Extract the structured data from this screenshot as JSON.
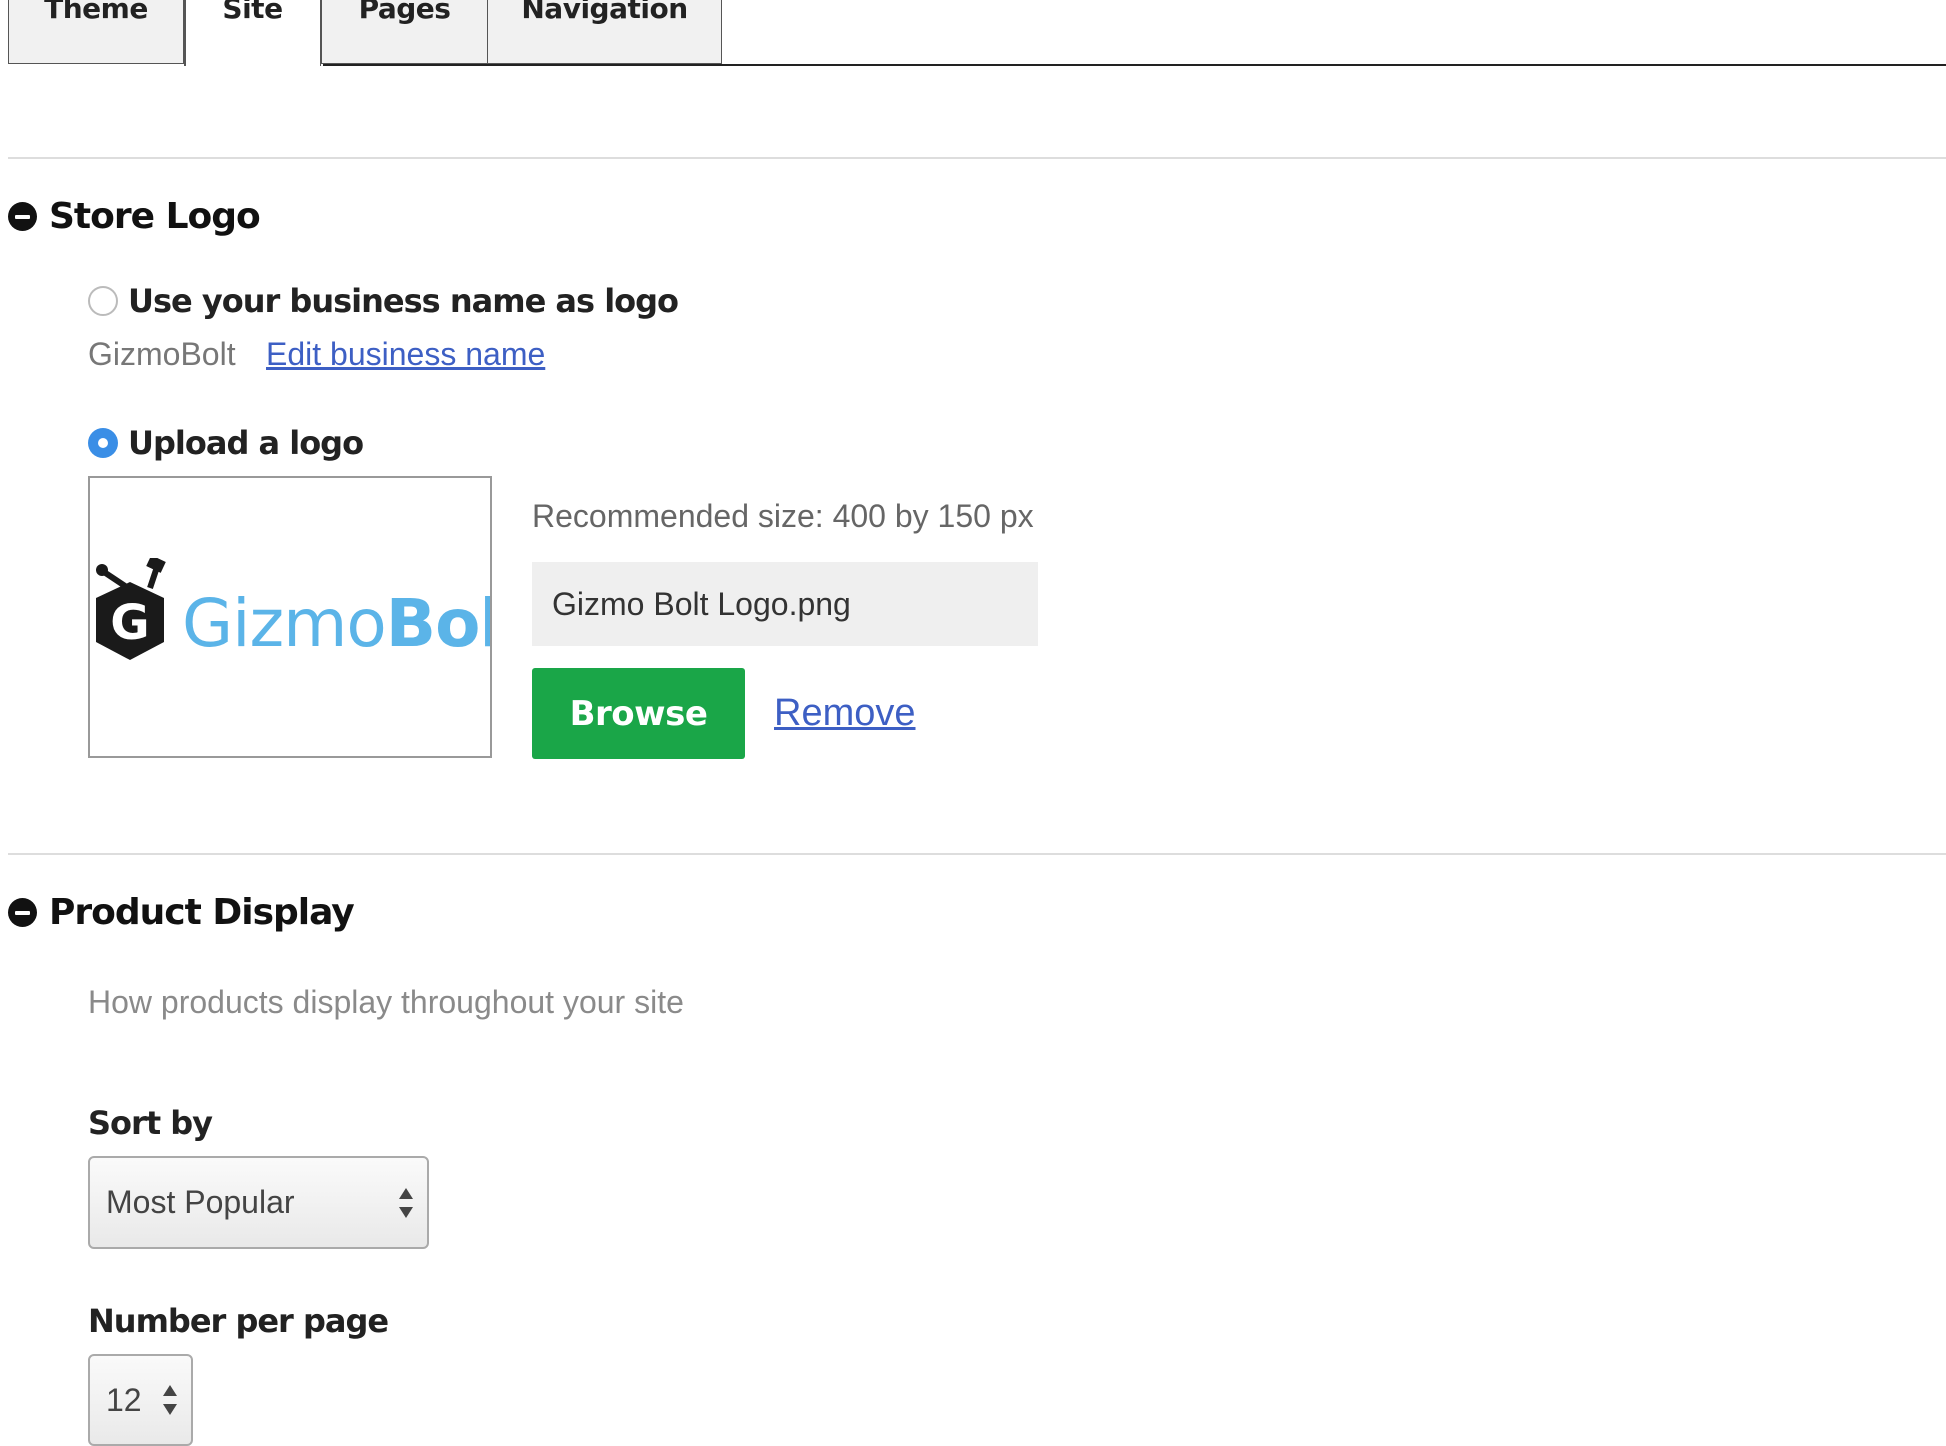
{
  "tabs": [
    {
      "label": "Theme",
      "active": false
    },
    {
      "label": "Site",
      "active": true
    },
    {
      "label": "Pages",
      "active": false
    },
    {
      "label": "Navigation",
      "active": false
    }
  ],
  "store_logo": {
    "title": "Store Logo",
    "option_business_name": {
      "label": "Use your business name as logo",
      "selected": false,
      "business_name": "GizmoBolt",
      "edit_link": "Edit business name"
    },
    "option_upload": {
      "label": "Upload a logo",
      "selected": true,
      "preview": {
        "text_light": "Gizmo",
        "text_bold": "Bolt",
        "mark_letter": "G"
      },
      "recommended_size": "Recommended size: 400 by 150 px",
      "file_name": "Gizmo Bolt Logo.png",
      "browse_label": "Browse",
      "remove_label": "Remove"
    }
  },
  "product_display": {
    "title": "Product Display",
    "description": "How products display throughout your site",
    "sort_by": {
      "label": "Sort by",
      "value": "Most Popular"
    },
    "per_page": {
      "label": "Number per page",
      "value": "12"
    }
  },
  "colors": {
    "accent_blue": "#3a8ee6",
    "link": "#3d5fc4",
    "browse_green": "#1aa648",
    "logo_blue": "#5bb4e8",
    "logo_dark": "#1a1a1a"
  }
}
